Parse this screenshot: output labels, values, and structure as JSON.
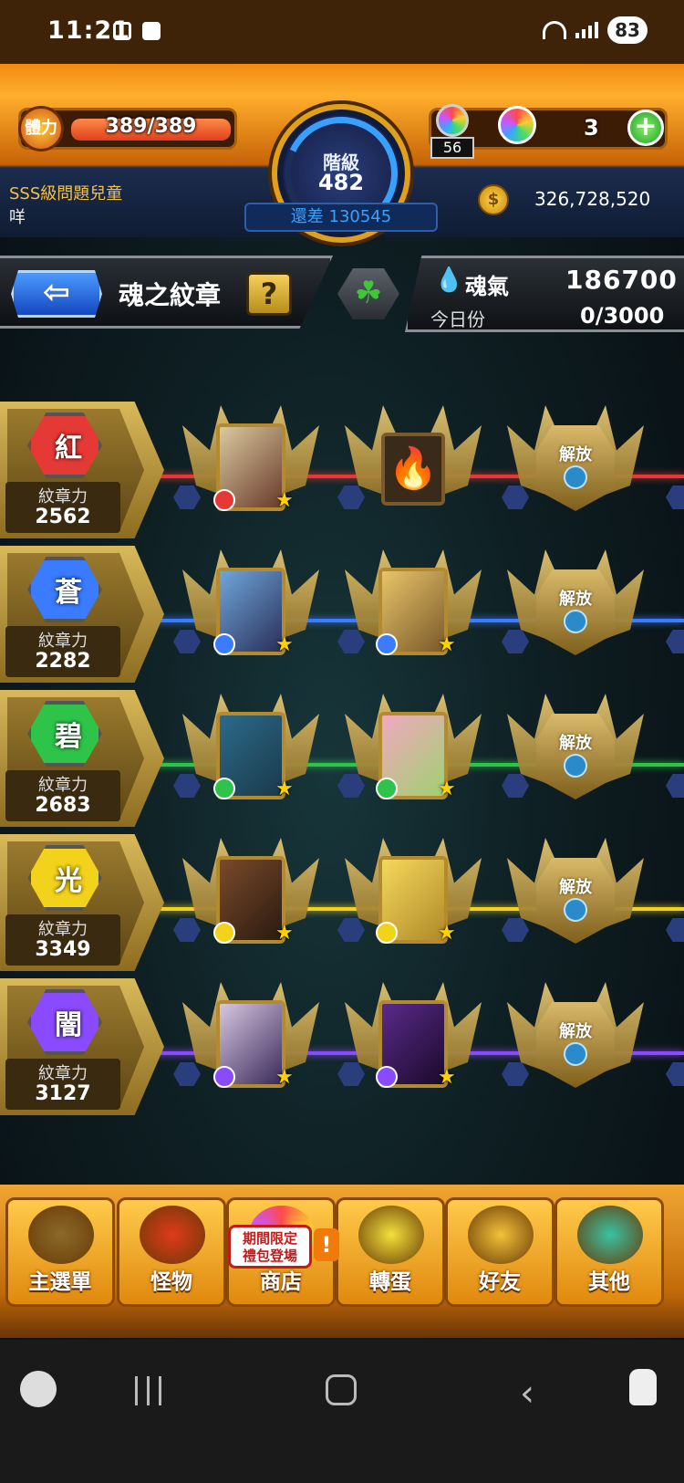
{
  "status_bar": {
    "time": "11:21",
    "battery": "83",
    "wifi_label": "5"
  },
  "header": {
    "stamina_icon_label": "體力",
    "stamina": "389/389",
    "stamina_fill": 1.0,
    "rank_label": "階級",
    "rank": "482",
    "lamp_count": "56",
    "gem_count": "3",
    "add_label": "+",
    "player_title": "SSS級問題兒童",
    "player_name": "咩",
    "exp_remaining": "還差 130545",
    "coin_icon": "coin-icon",
    "coins": "326,728,520"
  },
  "titlebar": {
    "back_label": "⇦",
    "title": "魂之紋章",
    "help_label": "?",
    "clover_label": "☘",
    "soul_label": "魂氣",
    "soul_value": "186700",
    "daily_label": "今日份",
    "daily_value": "0/3000"
  },
  "colors": {
    "red": "#e53935",
    "blue": "#3a7bff",
    "green": "#2ec44a",
    "yellow": "#f2d21a",
    "purple": "#8a4aff"
  },
  "rows": [
    {
      "attr": "紅",
      "power_label": "紋章力",
      "power": "2562",
      "color": "#e53935",
      "slot3_label": "解放"
    },
    {
      "attr": "蒼",
      "power_label": "紋章力",
      "power": "2282",
      "color": "#3a7bff",
      "slot3_label": "解放"
    },
    {
      "attr": "碧",
      "power_label": "紋章力",
      "power": "2683",
      "color": "#2ec44a",
      "slot3_label": "解放"
    },
    {
      "attr": "光",
      "power_label": "紋章力",
      "power": "3349",
      "color": "#f2d21a",
      "slot3_label": "解放"
    },
    {
      "attr": "闇",
      "power_label": "紋章力",
      "power": "3127",
      "color": "#8a4aff",
      "slot3_label": "解放"
    }
  ],
  "nav": {
    "items": [
      {
        "label": "主選單",
        "icon": "main-menu-icon"
      },
      {
        "label": "怪物",
        "icon": "monster-icon"
      },
      {
        "label": "商店",
        "icon": "shop-icon"
      },
      {
        "label": "轉蛋",
        "icon": "gacha-icon"
      },
      {
        "label": "好友",
        "icon": "friends-icon"
      },
      {
        "label": "其他",
        "icon": "other-icon"
      }
    ],
    "promo_badge": "期間限定\n禮包登場",
    "promo_excl": "!"
  }
}
